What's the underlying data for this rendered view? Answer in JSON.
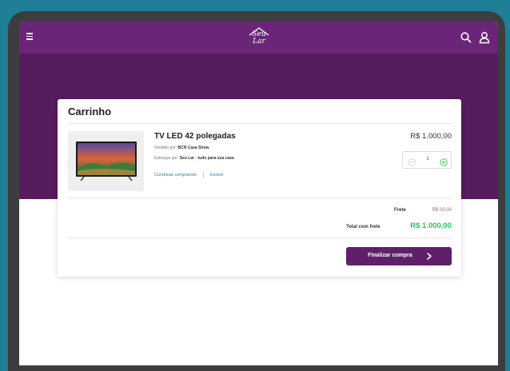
{
  "header": {
    "logo_line1": "Seu",
    "logo_line2": "Lar",
    "icons": [
      "menu-icon",
      "search-icon",
      "user-icon"
    ]
  },
  "cart": {
    "title": "Carrinho",
    "item": {
      "name": "TV LED 42 polegadas",
      "sold_by_label": "Vendido por:",
      "sold_by_value": "BCN Casa Show",
      "delivered_by_label": "Entregue por:",
      "delivered_by_value": "Seu Lar - tudo para sua casa",
      "continue_link": "Continuar comprando",
      "delete_link": "Excluir",
      "price": "R$ 1.000,00",
      "quantity": "1"
    },
    "summary": {
      "shipping_label": "Frete",
      "shipping_value": "R$ 00,00",
      "total_label": "Total com frete",
      "total_value": "R$ 1.000,00"
    },
    "checkout_label": "Finalizar compra"
  },
  "colors": {
    "topbar": "#6a2578",
    "hero": "#561c5e",
    "checkout_button": "#5f2069",
    "total_green": "#2ec25d",
    "link_blue": "#2a7ca6",
    "background": "#1e7f96",
    "device_frame": "#3d3d3f"
  }
}
